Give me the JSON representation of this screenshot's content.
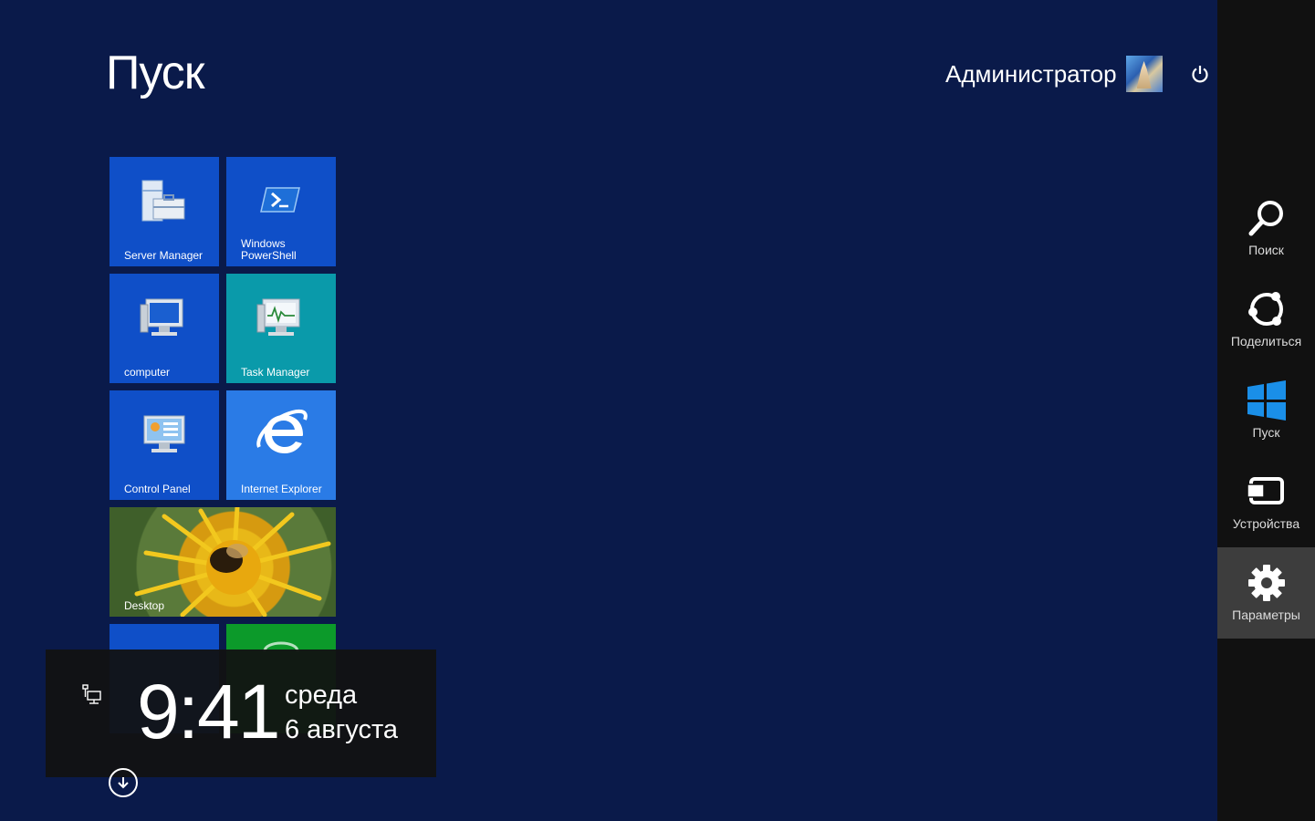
{
  "start": {
    "title": "Пуск"
  },
  "user": {
    "name": "Администратор"
  },
  "tiles": [
    {
      "label": "Server Manager",
      "color": "#0f4fc8"
    },
    {
      "label": "Windows\nPowerShell",
      "color": "#0f4fc8"
    },
    {
      "label": "computer",
      "color": "#0f4fc8"
    },
    {
      "label": "Task Manager",
      "color": "#0a9aaa"
    },
    {
      "label": "Control Panel",
      "color": "#0f4fc8"
    },
    {
      "label": "Internet Explorer",
      "color": "#2a7be6"
    },
    {
      "label": "Desktop"
    }
  ],
  "charms": [
    {
      "label": "Поиск",
      "icon": "search-icon"
    },
    {
      "label": "Поделиться",
      "icon": "share-icon"
    },
    {
      "label": "Пуск",
      "icon": "windows-logo-icon"
    },
    {
      "label": "Устройства",
      "icon": "devices-icon"
    },
    {
      "label": "Параметры",
      "icon": "gear-icon"
    }
  ],
  "clock": {
    "time": "9:41",
    "day": "среда",
    "date": "6 августа"
  }
}
